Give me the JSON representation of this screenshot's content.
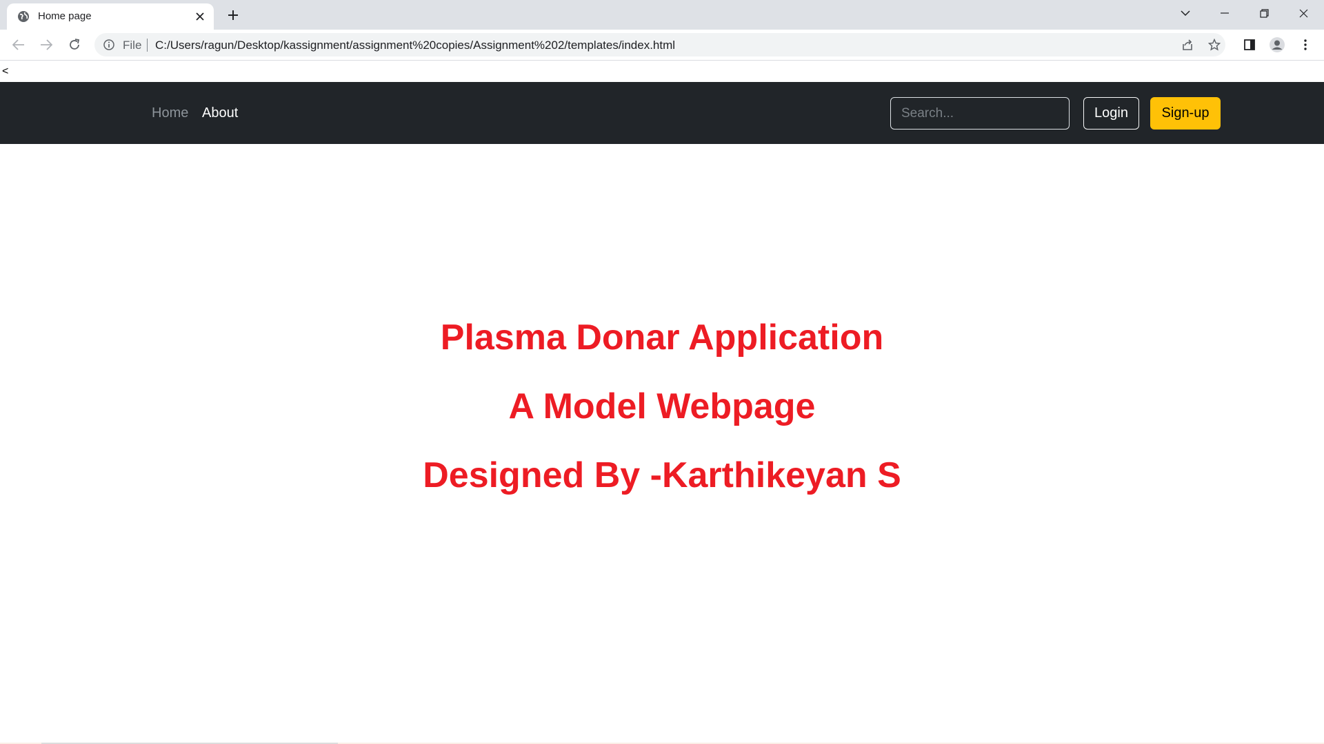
{
  "browser": {
    "tab_title": "Home page",
    "address_scheme_label": "File",
    "url": "C:/Users/ragun/Desktop/kassignment/assignment%20copies/Assignment%202/templates/index.html",
    "icons": [
      "globe-icon",
      "close-icon",
      "plus-icon",
      "chevron-down-icon",
      "minimize-icon",
      "restore-icon",
      "window-close-icon",
      "back-arrow-icon",
      "forward-arrow-icon",
      "reload-icon",
      "info-icon",
      "share-icon",
      "star-icon",
      "side-panel-icon",
      "profile-icon",
      "more-vertical-icon"
    ]
  },
  "page": {
    "stray_text": "<",
    "navbar": {
      "links": [
        {
          "label": "Home"
        },
        {
          "label": "About"
        }
      ],
      "search_placeholder": "Search...",
      "login_label": "Login",
      "signup_label": "Sign-up"
    },
    "hero": {
      "line1": "Plasma Donar Application",
      "line2": "A Model Webpage",
      "line3": "Designed By -Karthikeyan S"
    }
  },
  "colors": {
    "navbar_bg": "#212529",
    "signup_bg": "#ffc107",
    "hero_text": "#ed1c24"
  }
}
